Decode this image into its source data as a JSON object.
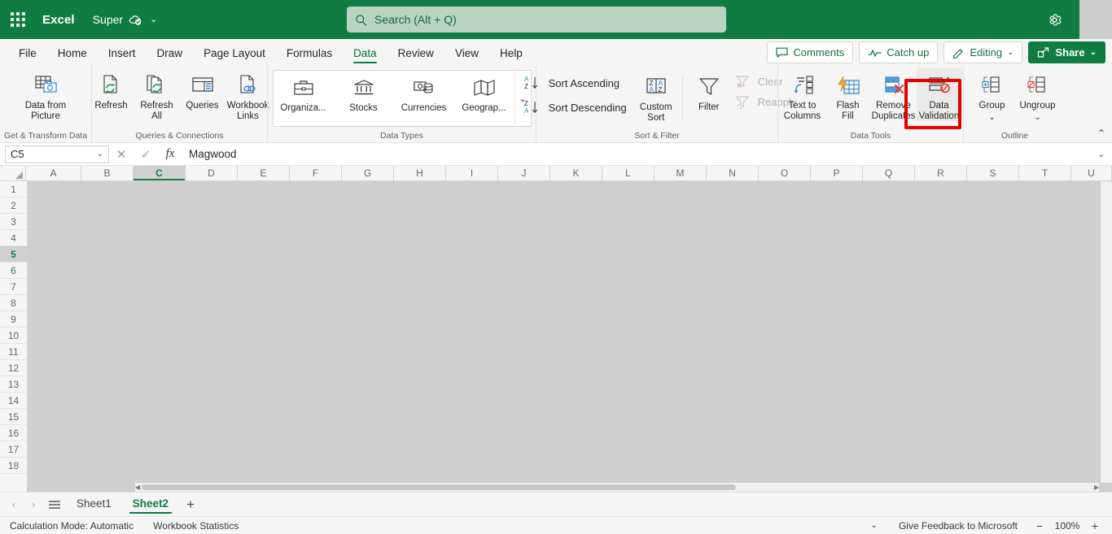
{
  "titlebar": {
    "app_name": "Excel",
    "doc_name": "Super",
    "waffle_name": "app-launcher",
    "cloud_status_icon": "cloud-saved-icon",
    "doc_chevron": "⌄",
    "gear_icon": "gear-icon"
  },
  "search": {
    "placeholder": "Search (Alt + Q)",
    "value": "",
    "icon": "search-icon"
  },
  "tabs": [
    {
      "label": "File",
      "active": false
    },
    {
      "label": "Home",
      "active": false
    },
    {
      "label": "Insert",
      "active": false
    },
    {
      "label": "Draw",
      "active": false
    },
    {
      "label": "Page Layout",
      "active": false
    },
    {
      "label": "Formulas",
      "active": false
    },
    {
      "label": "Data",
      "active": true
    },
    {
      "label": "Review",
      "active": false
    },
    {
      "label": "View",
      "active": false
    },
    {
      "label": "Help",
      "active": false
    }
  ],
  "tab_actions": {
    "comments": "Comments",
    "catch_up": "Catch up",
    "editing": "Editing",
    "share": "Share",
    "chevron": "⌄"
  },
  "ribbon": {
    "groups": [
      {
        "name": "Get & Transform Data",
        "items": [
          {
            "label": "Data from\nPicture",
            "label_line1": "Data from",
            "label_line2": "Picture",
            "icon": "data-from-picture-icon"
          }
        ]
      },
      {
        "name": "Queries & Connections",
        "items": [
          {
            "label_line1": "Refresh",
            "label_line2": "",
            "icon": "refresh-icon"
          },
          {
            "label_line1": "Refresh",
            "label_line2": "All",
            "icon": "refresh-all-icon"
          },
          {
            "label_line1": "Queries",
            "label_line2": "",
            "icon": "queries-icon"
          },
          {
            "label_line1": "Workbook",
            "label_line2": "Links",
            "icon": "workbook-links-icon"
          }
        ]
      },
      {
        "name": "Data Types",
        "expander": "⌄",
        "items": [
          {
            "label_line1": "Organiza...",
            "label_line2": "",
            "icon": "organization-icon"
          },
          {
            "label_line1": "Stocks",
            "label_line2": "",
            "icon": "stocks-icon"
          },
          {
            "label_line1": "Currencies",
            "label_line2": "",
            "icon": "currencies-icon"
          },
          {
            "label_line1": "Geograp...",
            "label_line2": "",
            "icon": "geography-icon"
          }
        ]
      },
      {
        "name": "Sort & Filter",
        "sort_ascending": "Sort Ascending",
        "sort_descending": "Sort Descending",
        "items": [
          {
            "label_line1": "Custom",
            "label_line2": "Sort",
            "icon": "custom-sort-icon"
          },
          {
            "label_line1": "Filter",
            "label_line2": "",
            "icon": "filter-icon"
          },
          {
            "label_line1": "Clear",
            "label_line2": "",
            "icon": "clear-filter-icon",
            "disabled": true
          },
          {
            "label_line1": "Reapply",
            "label_line2": "",
            "icon": "reapply-filter-icon",
            "disabled": true
          }
        ]
      },
      {
        "name": "Data Tools",
        "items": [
          {
            "label_line1": "Text to",
            "label_line2": "Columns",
            "icon": "text-to-columns-icon"
          },
          {
            "label_line1": "Flash",
            "label_line2": "Fill",
            "icon": "flash-fill-icon"
          },
          {
            "label_line1": "Remove",
            "label_line2": "Duplicates",
            "icon": "remove-duplicates-icon"
          },
          {
            "label_line1": "Data",
            "label_line2": "Validation",
            "icon": "data-validation-icon",
            "highlighted": true
          }
        ]
      },
      {
        "name": "Outline",
        "items": [
          {
            "label_line1": "Group",
            "label_line2": "",
            "icon": "group-icon",
            "chevron": "⌄"
          },
          {
            "label_line1": "Ungroup",
            "label_line2": "",
            "icon": "ungroup-icon",
            "chevron": "⌄"
          }
        ]
      }
    ],
    "collapse_caret": "⌃",
    "annotation_color": "#e60000"
  },
  "formula_bar": {
    "name_box_value": "C5",
    "name_box_chevron": "⌄",
    "cancel_icon": "cancel-icon",
    "confirm_icon": "confirm-icon",
    "function_icon": "fx",
    "formula_value": "Magwood",
    "expand_chevron": "⌄"
  },
  "grid": {
    "columns": [
      "A",
      "B",
      "C",
      "D",
      "E",
      "F",
      "G",
      "H",
      "I",
      "J",
      "K",
      "L",
      "M",
      "N",
      "O",
      "P",
      "Q",
      "R",
      "S",
      "T",
      "U"
    ],
    "selected_column": "C",
    "rows": [
      1,
      2,
      3,
      4,
      5,
      6,
      7,
      8,
      9,
      10,
      11,
      12,
      13,
      14,
      15,
      16,
      17,
      18
    ],
    "selected_row": 5,
    "selected_cell": "C5"
  },
  "sheet_bar": {
    "prev_icon": "‹",
    "next_icon": "›",
    "list_icon": "sheet-list-icon",
    "tabs": [
      {
        "label": "Sheet1",
        "active": false
      },
      {
        "label": "Sheet2",
        "active": true
      }
    ],
    "add_label": "+"
  },
  "status_bar": {
    "calculation_mode": "Calculation Mode: Automatic",
    "workbook_statistics": "Workbook Statistics",
    "chevron": "⌄",
    "feedback": "Give Feedback to Microsoft",
    "zoom_out": "−",
    "zoom_level": "100%",
    "zoom_in": "+"
  },
  "colors": {
    "brand_green": "#107c41",
    "ribbon_bg": "#f5f5f5",
    "annotation_red": "#e60000",
    "grid_grey": "#cfcfcf"
  }
}
